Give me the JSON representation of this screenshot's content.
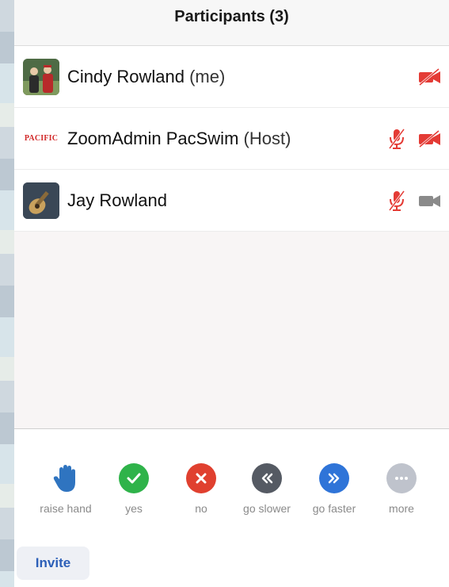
{
  "header": {
    "title": "Participants (3)"
  },
  "participants": [
    {
      "name": "Cindy Rowland",
      "suffix": "(me)",
      "avatar": "photo-avatar",
      "mic": "none",
      "video": "video-off"
    },
    {
      "name": "ZoomAdmin PacSwim",
      "suffix": "(Host)",
      "avatar_text": "PACIFIC",
      "mic": "mic-muted",
      "video": "video-off"
    },
    {
      "name": "Jay Rowland",
      "suffix": "",
      "avatar": "guitar-photo-avatar",
      "mic": "mic-muted",
      "video": "video-on"
    }
  ],
  "reactions": [
    {
      "label": "raise hand",
      "icon": "hand-icon",
      "color": "#2f74c0"
    },
    {
      "label": "yes",
      "icon": "check-icon",
      "color": "#2fb34a"
    },
    {
      "label": "no",
      "icon": "x-icon",
      "color": "#e0402f"
    },
    {
      "label": "go slower",
      "icon": "rewind-icon",
      "color": "#555a63"
    },
    {
      "label": "go faster",
      "icon": "fast-forward-icon",
      "color": "#2f74d8"
    },
    {
      "label": "more",
      "icon": "ellipsis-icon",
      "color": "#bfc3cc"
    }
  ],
  "footer": {
    "invite_label": "Invite"
  },
  "colors": {
    "muted_red": "#e43b35",
    "video_gray": "#8a8a8a",
    "accent_blue": "#2c5fb8"
  }
}
